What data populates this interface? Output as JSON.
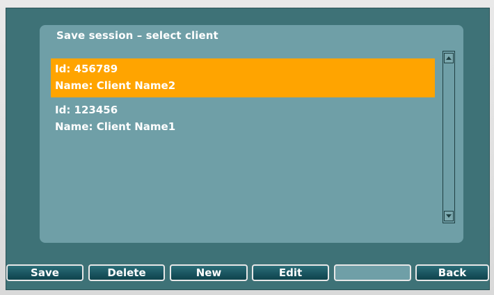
{
  "dialog": {
    "title": "Save session – select client"
  },
  "clients": [
    {
      "id_line": "Id: 456789",
      "name_line": "Name: Client Name2",
      "selected": true
    },
    {
      "id_line": "Id: 123456",
      "name_line": "Name: Client Name1",
      "selected": false
    }
  ],
  "toolbar": {
    "save_label": "Save",
    "delete_label": "Delete",
    "new_label": "New",
    "edit_label": "Edit",
    "blank_label": "",
    "back_label": "Back"
  },
  "colors": {
    "screen_bg": "#3e7277",
    "dialog_bg": "#6f9fa7",
    "selection": "#ffa400",
    "button_bg": "#1a5560"
  }
}
